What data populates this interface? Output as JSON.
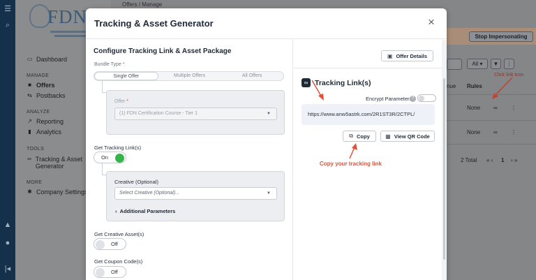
{
  "app": {
    "logo_text": "FDN",
    "breadcrumb": "Offers / Manage",
    "stop_impersonating": "Stop Impersonating",
    "sidebar": {
      "items": [
        {
          "label": "Dashboard",
          "icon": "monitor-icon",
          "section": ""
        },
        {
          "label": "Offers",
          "icon": "tag-icon",
          "section": "MANAGE",
          "active": true
        },
        {
          "label": "Postbacks",
          "icon": "arrow-left-right-icon",
          "section": "MANAGE"
        },
        {
          "label": "Reporting",
          "icon": "chart-icon",
          "section": "ANALYZE"
        },
        {
          "label": "Analytics",
          "icon": "bar-chart-icon",
          "section": "ANALYZE"
        },
        {
          "label": "Tracking & Asset Generator",
          "icon": "link-icon",
          "section": "TOOLS"
        },
        {
          "label": "Company Settings",
          "icon": "gear-icon",
          "section": "MORE"
        }
      ],
      "sections": [
        "MANAGE",
        "ANALYZE",
        "TOOLS",
        "MORE"
      ]
    },
    "table": {
      "filter_all": "All",
      "columns": [
        "nue",
        "Rules"
      ],
      "rows": [
        {
          "rules": "None"
        },
        {
          "rules": "None"
        }
      ],
      "total": "2 Total",
      "page": "1",
      "annotation": "Click link icon"
    }
  },
  "modal": {
    "title": "Tracking & Asset Generator",
    "close_label": "×",
    "left": {
      "heading": "Configure Tracking Link & Asset Package",
      "bundle_type_label": "Bundle Type",
      "required_mark": "*",
      "bundle_options": [
        "Single Offer",
        "Multiple Offers",
        "All Offers"
      ],
      "selected_bundle": "Single Offer",
      "offer_label": "Offer",
      "offer_value": "(1) FDN Certification Course - Tier 1",
      "get_tracking_link_label": "Get Tracking Link(s)",
      "tracking_toggle": "On",
      "creative_label": "Creative (Optional)",
      "creative_placeholder": "Select Creative (Optional)...",
      "additional_params": "Additional Parameters",
      "get_creative_label": "Get Creative Asset(s)",
      "creative_toggle": "Off",
      "get_coupon_label": "Get Coupon Code(s)",
      "coupon_toggle": "Off"
    },
    "right": {
      "offer_details_button": "Offer Details",
      "tracking_links_title": "Tracking Link(s)",
      "encrypt_label": "Encrypt Parameters",
      "help_glyph": "?",
      "tracking_url": "https://www.anw5astrk.com/2R1ST3R/2CTPL/",
      "copy_button": "Copy",
      "qr_button": "View QR Code",
      "annotation": "Copy your tracking link"
    },
    "colors": {
      "toggle_on": "#35b44a",
      "annotation": "#e0503a"
    }
  }
}
